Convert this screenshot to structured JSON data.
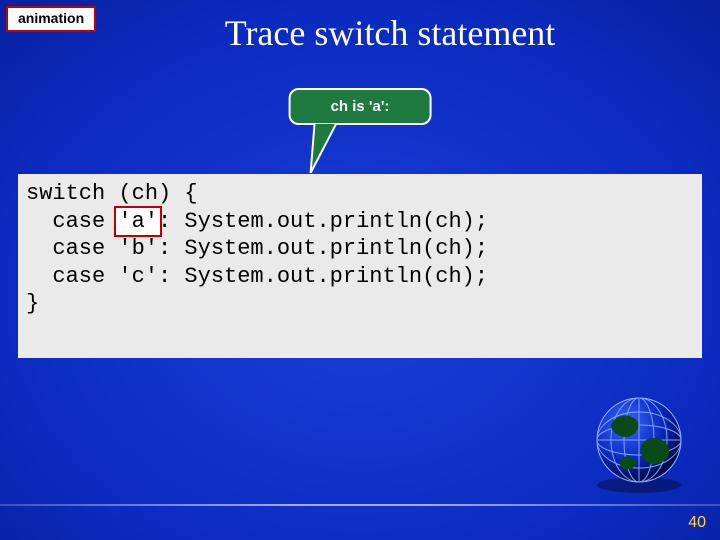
{
  "tag": "animation",
  "title": "Trace switch statement",
  "callout": "ch is 'a':",
  "code": {
    "l1a": "switch (ch) {",
    "l2a": "  case ",
    "l2hl": "'a'",
    "l2b": ": System.out.println(ch);",
    "l3": "  case 'b': System.out.println(ch);",
    "l4": "  case 'c': System.out.println(ch);",
    "l5": "}"
  },
  "page_number": "40"
}
